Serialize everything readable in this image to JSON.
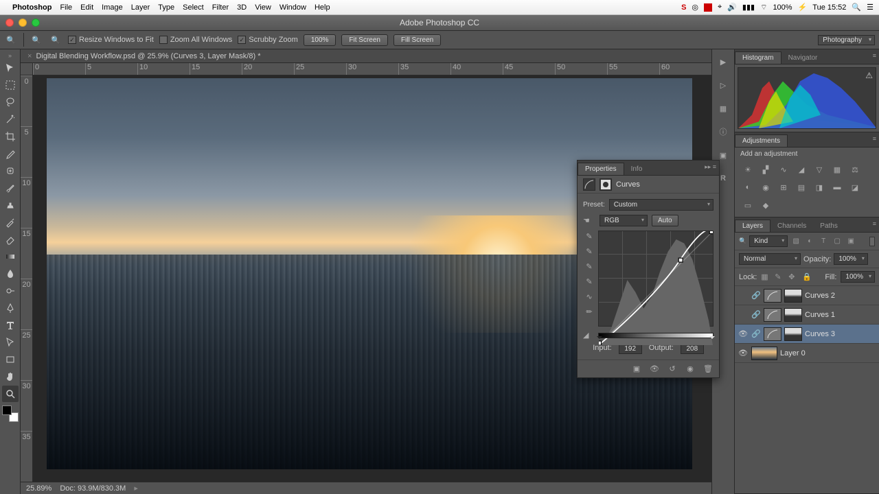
{
  "mac": {
    "app": "Photoshop",
    "menus": [
      "File",
      "Edit",
      "Image",
      "Layer",
      "Type",
      "Select",
      "Filter",
      "3D",
      "View",
      "Window",
      "Help"
    ],
    "battery": "100%",
    "clock": "Tue 15:52"
  },
  "window": {
    "title": "Adobe Photoshop CC"
  },
  "options": {
    "resize_label": "Resize Windows to Fit",
    "zoom_all_label": "Zoom All Windows",
    "scrubby_label": "Scrubby Zoom",
    "zoom_pct": "100%",
    "fit_screen": "Fit Screen",
    "fill_screen": "Fill Screen",
    "workspace": "Photography"
  },
  "document": {
    "tab": "Digital Blending Workflow.psd @ 25.9% (Curves 3, Layer Mask/8) *",
    "zoom_status": "25.89%",
    "doc_status": "Doc: 93.9M/830.3M",
    "ruler_h": [
      "0",
      "5",
      "10",
      "15",
      "20",
      "25",
      "30",
      "35",
      "40",
      "45",
      "50",
      "55",
      "60"
    ],
    "ruler_v": [
      "0",
      "5",
      "10",
      "15",
      "20",
      "25",
      "30",
      "35"
    ]
  },
  "properties": {
    "tabs": {
      "properties": "Properties",
      "info": "Info"
    },
    "type_label": "Curves",
    "preset_label": "Preset:",
    "preset_value": "Custom",
    "channel_value": "RGB",
    "auto_label": "Auto",
    "input_label": "Input:",
    "input_value": "192",
    "output_label": "Output:",
    "output_value": "208"
  },
  "right": {
    "histogram_tab": "Histogram",
    "navigator_tab": "Navigator",
    "adjustments_tab": "Adjustments",
    "add_adj_label": "Add an adjustment",
    "layers_tab": "Layers",
    "channels_tab": "Channels",
    "paths_tab": "Paths",
    "kind_label": "Kind",
    "blend_mode": "Normal",
    "opacity_label": "Opacity:",
    "opacity_value": "100%",
    "lock_label": "Lock:",
    "fill_label": "Fill:",
    "fill_value": "100%",
    "layers": [
      {
        "name": "Curves 2",
        "visible": false,
        "selected": false,
        "type": "adj"
      },
      {
        "name": "Curves 1",
        "visible": false,
        "selected": false,
        "type": "adj"
      },
      {
        "name": "Curves 3",
        "visible": true,
        "selected": true,
        "type": "adj"
      },
      {
        "name": "Layer 0",
        "visible": true,
        "selected": false,
        "type": "img"
      }
    ]
  }
}
